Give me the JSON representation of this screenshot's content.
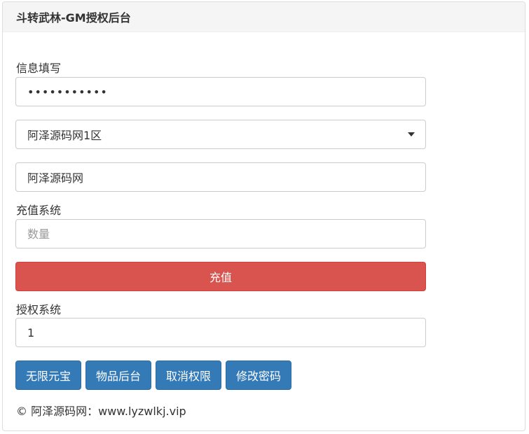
{
  "header": {
    "title": "斗转武林-GM授权后台"
  },
  "info": {
    "label": "信息填写",
    "password_value": "•••••••••••",
    "server_selected": "阿泽源码网1区",
    "role_value": "阿泽源码网"
  },
  "recharge": {
    "label": "充值系统",
    "quantity_placeholder": "数量",
    "submit_label": "充值"
  },
  "auth": {
    "label": "授权系统",
    "value": "1",
    "buttons": [
      "无限元宝",
      "物品后台",
      "取消权限",
      "修改密码"
    ]
  },
  "footer": {
    "text": "© 阿泽源码网：www.lyzwlkj.vip"
  }
}
